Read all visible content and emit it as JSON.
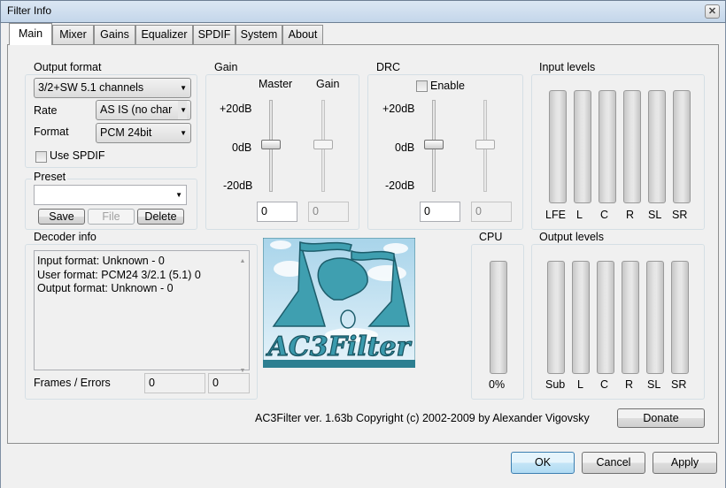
{
  "window": {
    "title": "Filter Info",
    "close": "✕"
  },
  "tabs": [
    "Main",
    "Mixer",
    "Gains",
    "Equalizer",
    "SPDIF",
    "System",
    "About"
  ],
  "output_format": {
    "label": "Output format",
    "channels": "3/2+SW 5.1 channels",
    "rate_label": "Rate",
    "rate": "AS IS (no char",
    "format_label": "Format",
    "format": "PCM 24bit",
    "use_spdif": "Use SPDIF",
    "use_spdif_checked": false
  },
  "preset": {
    "label": "Preset",
    "value": "",
    "save": "Save",
    "file": "File",
    "delete": "Delete"
  },
  "gain": {
    "label": "Gain",
    "master_label": "Master",
    "gain_label": "Gain",
    "scale": [
      "+20dB",
      "0dB",
      "-20dB"
    ],
    "master_value": "0",
    "gain_value": "0"
  },
  "drc": {
    "label": "DRC",
    "enable": "Enable",
    "enable_checked": false,
    "scale": [
      "+20dB",
      "0dB",
      "-20dB"
    ],
    "value1": "0",
    "value2": "0"
  },
  "input_levels": {
    "label": "Input levels",
    "channels": [
      "LFE",
      "L",
      "C",
      "R",
      "SL",
      "SR"
    ]
  },
  "decoder_info": {
    "label": "Decoder info",
    "lines": [
      "Input format: Unknown - 0",
      "User format: PCM24 3/2.1 (5.1) 0",
      "Output format: Unknown - 0"
    ],
    "frames_label": "Frames / Errors",
    "frames": "0",
    "errors": "0"
  },
  "logo": {
    "text": "AC3Filter"
  },
  "cpu": {
    "label": "CPU",
    "value": "0%"
  },
  "output_levels": {
    "label": "Output levels",
    "channels": [
      "Sub",
      "L",
      "C",
      "R",
      "SL",
      "SR"
    ]
  },
  "footer": {
    "copyright": "AC3Filter ver. 1.63b Copyright (c) 2002-2009 by Alexander Vigovsky",
    "donate": "Donate"
  },
  "buttons": {
    "ok": "OK",
    "cancel": "Cancel",
    "apply": "Apply"
  }
}
